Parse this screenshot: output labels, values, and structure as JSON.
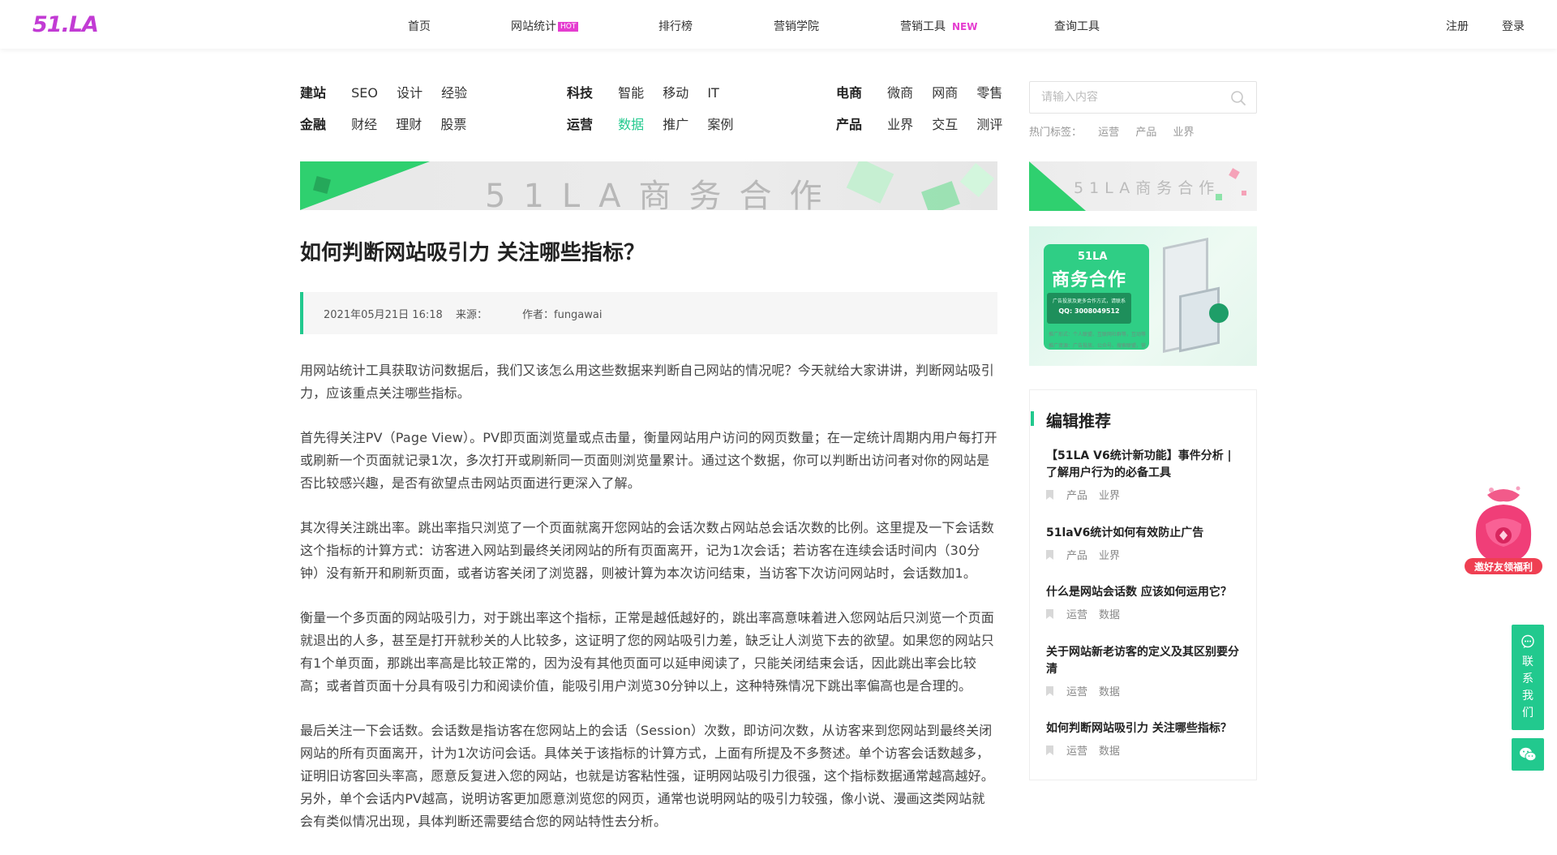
{
  "header": {
    "logo": "51.LA",
    "nav": [
      {
        "label": "首页"
      },
      {
        "label": "网站统计",
        "badge": "HOT"
      },
      {
        "label": "排行榜"
      },
      {
        "label": "营销学院"
      },
      {
        "label": "营销工具",
        "badge": "NEW"
      },
      {
        "label": "查询工具"
      }
    ],
    "register": "注册",
    "login": "登录"
  },
  "categories": [
    {
      "lead": "建站",
      "subs": [
        "SEO",
        "设计",
        "经验"
      ]
    },
    {
      "lead": "科技",
      "subs": [
        "智能",
        "移动",
        "IT"
      ]
    },
    {
      "lead": "电商",
      "subs": [
        "微商",
        "网商",
        "零售"
      ]
    },
    {
      "lead": "金融",
      "subs": [
        "财经",
        "理财",
        "股票"
      ]
    },
    {
      "lead": "运营",
      "subs": [
        "数据",
        "推广",
        "案例"
      ]
    },
    {
      "lead": "产品",
      "subs": [
        "业界",
        "交互",
        "测评"
      ]
    }
  ],
  "search": {
    "placeholder": "请输入内容",
    "hot_label": "热门标签：",
    "hot_tags": [
      "运营",
      "产品",
      "业界"
    ]
  },
  "banners": {
    "main_text": "51LA商务合作",
    "side_text": "51LA商务合作",
    "side2": {
      "brand": "51LA",
      "title": "商务合作",
      "qq_line1": "广告投放及更多合作方式，请联系",
      "qq_line2": "QQ: 3008049512",
      "line_a": "推广形式：个人联盟、互联网社群等，互动等",
      "line_b": "推广资源：广告投放、公众号、搜索联盟，营"
    }
  },
  "article": {
    "title": "如何判断网站吸引力 关注哪些指标？",
    "date": "2021年05月21日 16:18",
    "source_label": "来源：",
    "author": "作者：fungawai",
    "paragraphs": [
      "用网站统计工具获取访问数据后，我们又该怎么用这些数据来判断自己网站的情况呢？今天就给大家讲讲，判断网站吸引力，应该重点关注哪些指标。",
      "首先得关注PV（Page View）。PV即页面浏览量或点击量，衡量网站用户访问的网页数量；在一定统计周期内用户每打开或刷新一个页面就记录1次，多次打开或刷新同一页面则浏览量累计。通过这个数据，你可以判断出访问者对你的网站是否比较感兴趣，是否有欲望点击网站页面进行更深入了解。",
      "其次得关注跳出率。跳出率指只浏览了一个页面就离开您网站的会话次数占网站总会话次数的比例。这里提及一下会话数这个指标的计算方式：访客进入网站到最终关闭网站的所有页面离开，记为1次会话；若访客在连续会话时间内（30分钟）没有新开和刷新页面，或者访客关闭了浏览器，则被计算为本次访问结束，当访客下次访问网站时，会话数加1。",
      "衡量一个多页面的网站吸引力，对于跳出率这个指标，正常是越低越好的，跳出率高意味着进入您网站后只浏览一个页面就退出的人多，甚至是打开就秒关的人比较多，这证明了您的网站吸引力差，缺乏让人浏览下去的欲望。如果您的网站只有1个单页面，那跳出率高是比较正常的，因为没有其他页面可以延申阅读了，只能关闭结束会话，因此跳出率会比较高；或者首页面十分具有吸引力和阅读价值，能吸引用户浏览30分钟以上，这种特殊情况下跳出率偏高也是合理的。",
      "最后关注一下会话数。会话数是指访客在您网站上的会话（Session）次数，即访问次数，从访客来到您网站到最终关闭网站的所有页面离开，计为1次访问会话。具体关于该指标的计算方式，上面有所提及不多赘述。单个访客会话数越多，证明旧访客回头率高，愿意反复进入您的网站，也就是访客粘性强，证明网站吸引力很强，这个指标数据通常越高越好。另外，单个会话内PV越高，说明访客更加愿意浏览您的网页，通常也说明网站的吸引力较强，像小说、漫画这类网站就会有类似情况出现，具体判断还需要结合您的网站特性去分析。"
    ]
  },
  "recommend": {
    "title": "编辑推荐",
    "items": [
      {
        "title": "【51LA V6统计新功能】事件分析 | 了解用户行为的必备工具",
        "tags": [
          "产品",
          "业界"
        ]
      },
      {
        "title": "51laV6统计如何有效防止广告",
        "tags": [
          "产品",
          "业界"
        ]
      },
      {
        "title": "什么是网站会话数 应该如何运用它？",
        "tags": [
          "运营",
          "数据"
        ]
      },
      {
        "title": "关于网站新老访客的定义及其区别要分清",
        "tags": [
          "运营",
          "数据"
        ]
      },
      {
        "title": "如何判断网站吸引力 关注哪些指标？",
        "tags": [
          "运营",
          "数据"
        ]
      }
    ]
  },
  "floating": {
    "gift_label": "邀好友领福利",
    "contact_label": "联系我们"
  },
  "colors": {
    "accent": "#22c98e",
    "brand": "#c23bd4",
    "hot_badge": "#e53dd0"
  }
}
